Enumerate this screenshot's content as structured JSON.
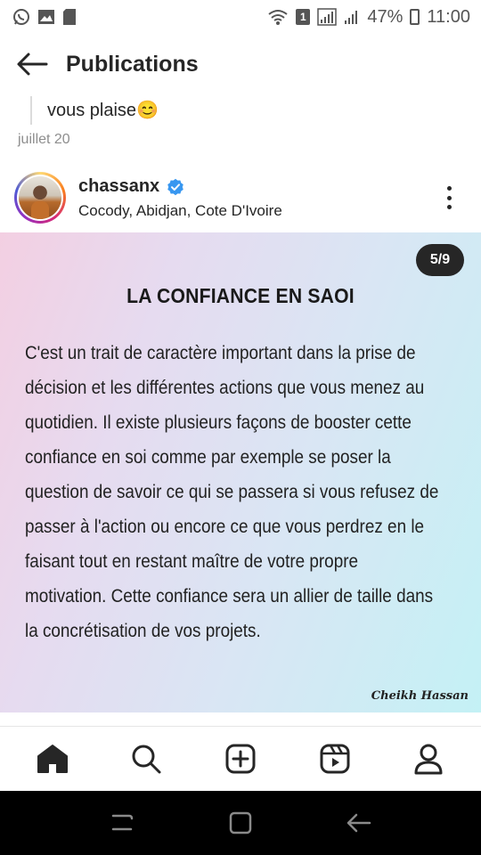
{
  "status_bar": {
    "battery_percent": "47%",
    "time": "11:00",
    "sim_label": "1",
    "icons_left": [
      "whatsapp-icon",
      "gallery-icon",
      "sd-card-icon"
    ],
    "icons_right": [
      "wifi-icon",
      "sim-icon",
      "signal-icon",
      "signal-icon",
      "battery-icon"
    ]
  },
  "header": {
    "title": "Publications"
  },
  "previous_post": {
    "caption_tail": "vous plaise😊",
    "date": "juillet 20"
  },
  "post": {
    "username": "chassanx",
    "verified": true,
    "location": "Cocody, Abidjan, Cote D'Ivoire",
    "carousel_counter": "5/9",
    "image_title": "LA CONFIANCE EN SAOI",
    "image_body_lines": [
      " C'est un trait de caractère important dans la prise de",
      "décision et les différentes actions que vous menez au",
      "quotidien. Il existe plusieurs façons de booster cette",
      "confiance en soi comme par exemple  se poser la",
      "question de savoir ce qui se passera  si vous refusez de",
      "passer à l'action ou encore ce que  vous perdrez en le",
      "faisant tout en restant maître de votre propre",
      "motivation. Cette confiance sera un allier de taille dans",
      "la concrétisation de vos projets."
    ],
    "image_signature": "Cheikh Hassan"
  },
  "bottom_nav": {
    "items": [
      "home-icon",
      "search-icon",
      "new-post-icon",
      "reels-icon",
      "profile-icon"
    ]
  },
  "system_nav": {
    "items": [
      "recent-apps-icon",
      "home-button-icon",
      "back-icon"
    ]
  },
  "colors": {
    "verified_blue": "#3897f0",
    "text": "#262626",
    "muted": "#8e8e8e"
  }
}
